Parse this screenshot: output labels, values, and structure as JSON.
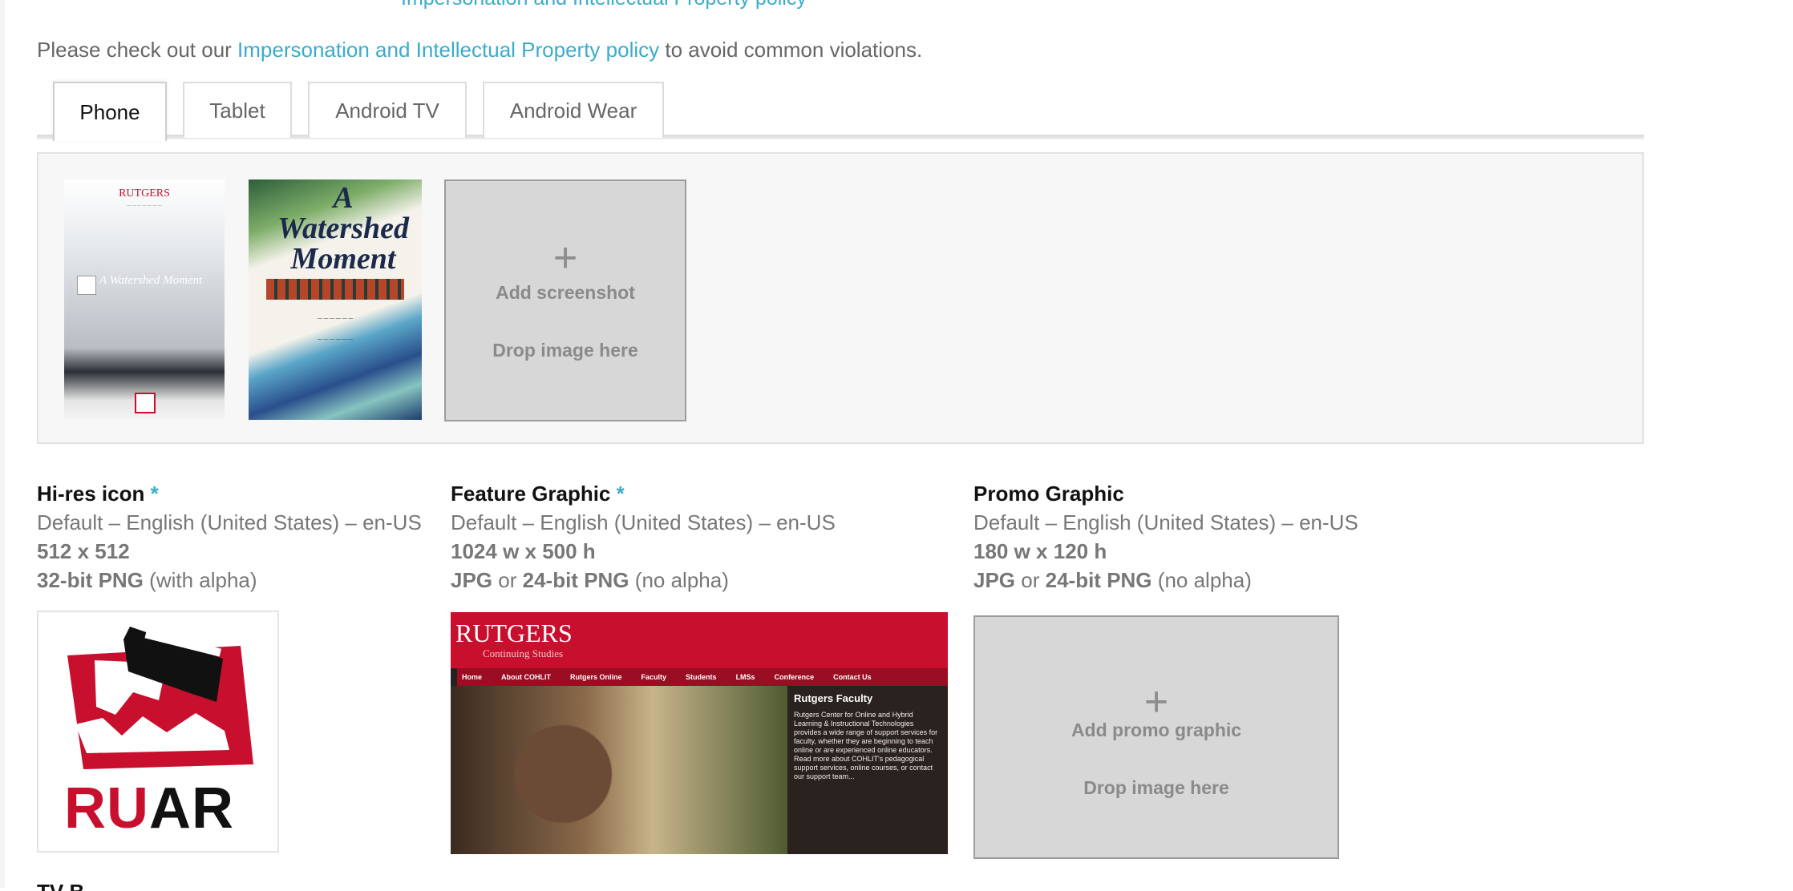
{
  "top_partial": {
    "text": "Impersonation and Intellectual Property policy"
  },
  "policy_line": {
    "prefix": "Please check out our",
    "link": "Impersonation and Intellectual Property policy",
    "suffix": "to avoid common violations."
  },
  "device_tabs": [
    {
      "label": "Phone",
      "active": true
    },
    {
      "label": "Tablet",
      "active": false
    },
    {
      "label": "Android TV",
      "active": false
    },
    {
      "label": "Android Wear",
      "active": false
    }
  ],
  "screenshots": {
    "items": [
      {
        "name": "screenshot-1",
        "logo": "RUTGERS",
        "title": "A Watershed Moment"
      },
      {
        "name": "screenshot-2",
        "title": "A Watershed Moment"
      }
    ],
    "add_label": "Add screenshot",
    "drop_label": "Drop image here",
    "plus_glyph": "+"
  },
  "assets": {
    "hires_icon": {
      "title": "Hi-res icon",
      "required_mark": "*",
      "locale": "Default – English (United States) – en-US",
      "size": "512 x 512",
      "format_bold": "32-bit PNG",
      "format_note": "(with alpha)",
      "preview_text_red": "RU",
      "preview_text_black": "AR"
    },
    "feature_graphic": {
      "title": "Feature Graphic",
      "required_mark": "*",
      "locale": "Default – English (United States) – en-US",
      "size": "1024 w x 500 h",
      "format_bold_1": "JPG",
      "format_or": "or",
      "format_bold_2": "24-bit PNG",
      "format_note": "(no alpha)",
      "preview": {
        "logo": "RUTGERS",
        "subtitle": "Continuing Studies",
        "nav": [
          "Home",
          "About COHLIT",
          "Rutgers Online",
          "Faculty",
          "Students",
          "LMSs",
          "Conference",
          "Contact Us"
        ],
        "panel_title": "Rutgers Faculty",
        "panel_body": "Rutgers Center for Online and Hybrid Learning & Instructional Technologies provides a wide range of support services for faculty, whether they are beginning to teach online or are experienced online educators. Read more about COHLIT's pedagogical support services, online courses, or contact our support team..."
      }
    },
    "promo_graphic": {
      "title": "Promo Graphic",
      "locale": "Default – English (United States) – en-US",
      "size": "180 w x 120 h",
      "format_bold_1": "JPG",
      "format_or": "or",
      "format_bold_2": "24-bit PNG",
      "format_note": "(no alpha)",
      "add_label": "Add promo graphic",
      "drop_label": "Drop image here",
      "plus_glyph": "+"
    }
  },
  "next_section_partial": {
    "title": "TV B"
  },
  "colors": {
    "link": "#3aaccb",
    "brand_red": "#c8102e",
    "drop_zone": "#d7d7d7"
  }
}
